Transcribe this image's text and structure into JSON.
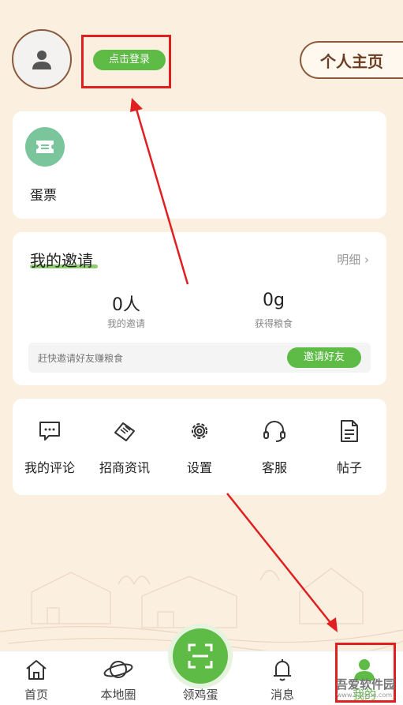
{
  "header": {
    "login_label": "点击登录",
    "profile_label": "个人主页"
  },
  "ticket_card": {
    "label": "蛋票",
    "icon": "ticket-icon"
  },
  "invite_card": {
    "title": "我的邀请",
    "detail_label": "明细",
    "stats": [
      {
        "value": "0人",
        "label": "我的邀请"
      },
      {
        "value": "0g",
        "label": "获得粮食"
      }
    ],
    "hint": "赶快邀请好友赚粮食",
    "button_label": "邀请好友"
  },
  "tools": [
    {
      "label": "我的评论",
      "icon": "comment-icon"
    },
    {
      "label": "招商资讯",
      "icon": "handshake-icon"
    },
    {
      "label": "设置",
      "icon": "gear-icon"
    },
    {
      "label": "客服",
      "icon": "headset-icon"
    },
    {
      "label": "帖子",
      "icon": "document-icon"
    }
  ],
  "tabbar": {
    "items": [
      {
        "label": "首页",
        "icon": "home-icon"
      },
      {
        "label": "本地圈",
        "icon": "planet-icon"
      },
      {
        "label": "领鸡蛋",
        "icon": "scan-icon"
      },
      {
        "label": "消息",
        "icon": "bell-icon"
      },
      {
        "label": "我的",
        "icon": "user-icon"
      }
    ]
  },
  "watermark": {
    "text": "吾爱软件园",
    "url": "www.52zxue.com"
  },
  "colors": {
    "accent_green": "#5dbb46",
    "background": "#fbefe0",
    "brown": "#8b5a3c",
    "annotation_red": "#e02020"
  }
}
